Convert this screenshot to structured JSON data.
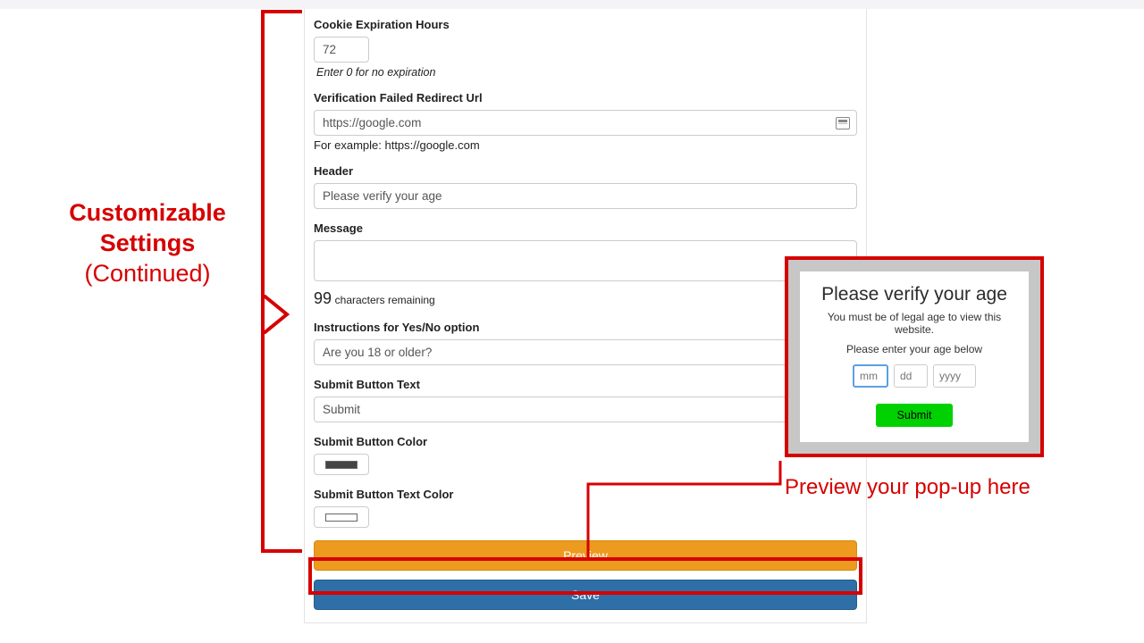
{
  "left_annotation": {
    "line1": "Customizable",
    "line2": "Settings",
    "continued": "(Continued)"
  },
  "right_annotation": "Preview your pop-up here",
  "form": {
    "cookie_exp": {
      "label": "Cookie Expiration Hours",
      "value": "72",
      "helper": "Enter 0 for no expiration"
    },
    "redirect": {
      "label": "Verification Failed Redirect Url",
      "value": "https://google.com",
      "helper": "For example: https://google.com"
    },
    "header": {
      "label": "Header",
      "value": "Please verify your age"
    },
    "message": {
      "label": "Message",
      "value": "",
      "remaining_count": "99",
      "remaining_text": "characters remaining"
    },
    "instructions": {
      "label": "Instructions for Yes/No option",
      "value": "Are you 18 or older?"
    },
    "submit_text": {
      "label": "Submit Button Text",
      "value": "Submit"
    },
    "submit_color": {
      "label": "Submit Button Color",
      "hex": "#444444"
    },
    "submit_text_color": {
      "label": "Submit Button Text Color",
      "hex": "#ffffff"
    },
    "preview_btn": "Preview",
    "save_btn": "Save"
  },
  "popup": {
    "title": "Please verify your age",
    "subtitle": "You must be of legal age to view this website.",
    "instruction": "Please enter your age below",
    "mm_placeholder": "mm",
    "dd_placeholder": "dd",
    "yyyy_placeholder": "yyyy",
    "submit": "Submit"
  }
}
